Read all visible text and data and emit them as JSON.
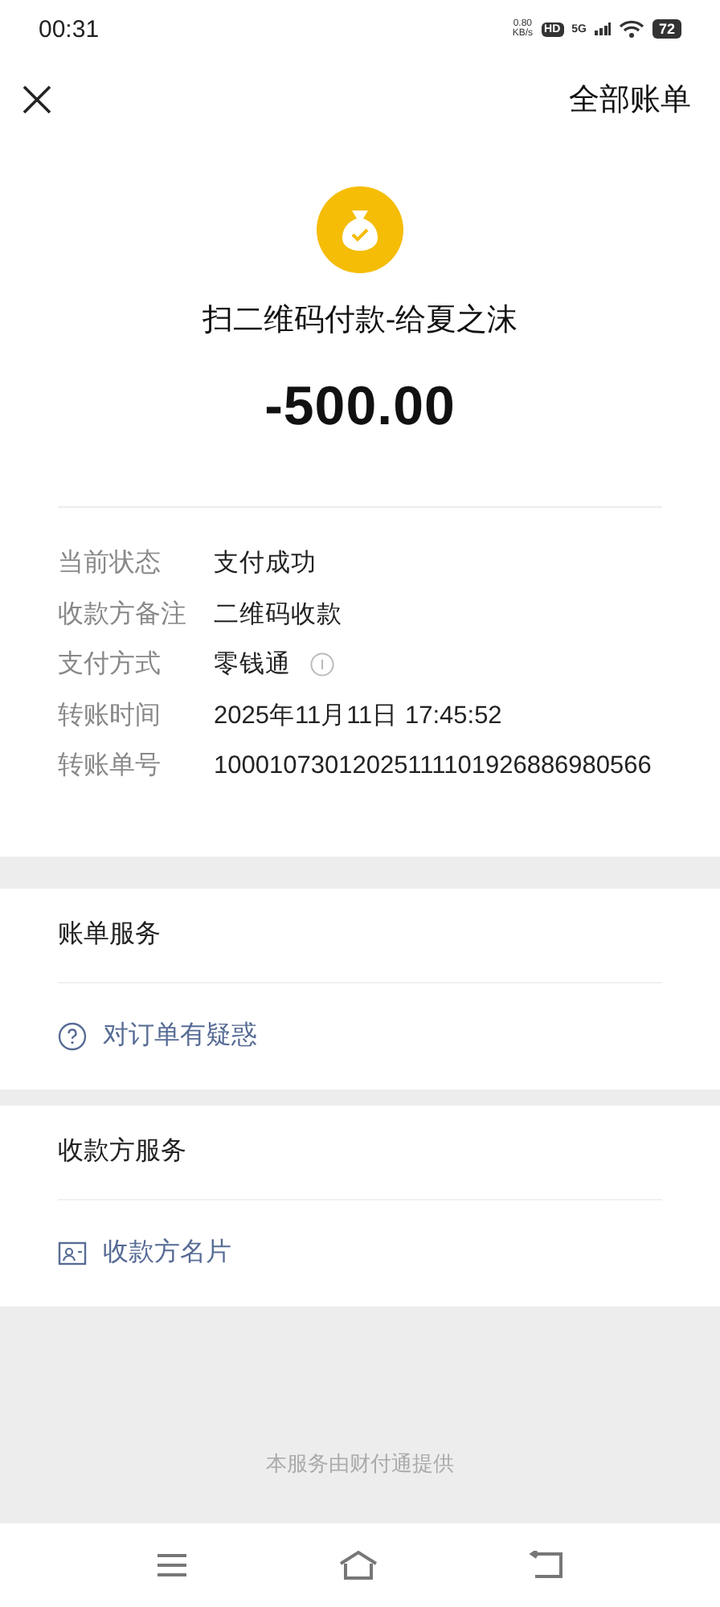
{
  "status_bar": {
    "time": "00:31",
    "net_speed": "0.80",
    "net_unit": "KB/s",
    "hd": "HD",
    "network": "5G",
    "battery": "72"
  },
  "nav": {
    "right_link": "全部账单"
  },
  "header": {
    "title": "扫二维码付款-给夏之沫",
    "amount": "-500.00"
  },
  "details": [
    {
      "label": "当前状态",
      "value": "支付成功",
      "info_icon": false
    },
    {
      "label": "收款方备注",
      "value": "二维码收款",
      "info_icon": false
    },
    {
      "label": "支付方式",
      "value": "零钱通",
      "info_icon": true
    },
    {
      "label": "转账时间",
      "value": "2025年11月11日 17:45:52",
      "info_icon": false
    },
    {
      "label": "转账单号",
      "value": "10001073012025111101926886980566",
      "info_icon": false
    }
  ],
  "services": [
    {
      "title": "账单服务",
      "link": {
        "kind": "help",
        "label": "对订单有疑惑"
      }
    },
    {
      "title": "收款方服务",
      "link": {
        "kind": "card",
        "label": "收款方名片"
      }
    }
  ],
  "footer": "本服务由财付通提供"
}
